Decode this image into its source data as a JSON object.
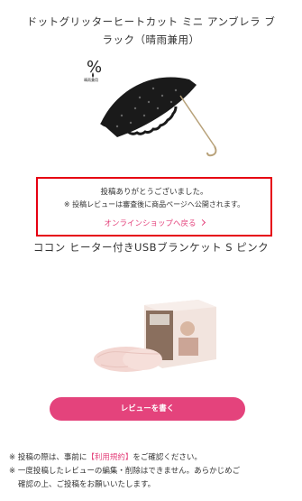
{
  "product1": {
    "title_line1": "ドットグリッターヒートカット ミニ アンブレラ ブ",
    "title_line2": "ラック（晴雨兼用）",
    "badge_symbol": "%",
    "badge_text": "晴雨兼用"
  },
  "thanks": {
    "line1": "投稿ありがとうございました。",
    "line2": "※ 投稿レビューは審査後に商品ページへ公開されます。",
    "back_link": "オンラインショップへ戻る"
  },
  "product2": {
    "title": "ココン ヒーター付きUSBブランケット S ピンク"
  },
  "review_button": "レビューを書く",
  "notes": {
    "n1_pre": "※ 投稿の際は、事前に",
    "n1_link": "【利用規約】",
    "n1_post": "をご確認ください。",
    "n2_line1": "※ 一度投稿したレビューの編集・削除はできません。あらかじめご",
    "n2_line2": "確認の上、ご投稿をお願いいたします。"
  },
  "colors": {
    "accent": "#e4437c",
    "highlight_border": "#e60012"
  }
}
